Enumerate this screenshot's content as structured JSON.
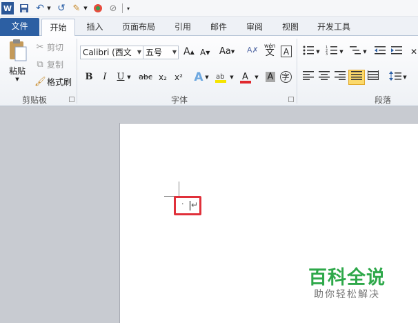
{
  "quick_access": {
    "icons": [
      "word-icon",
      "save-icon",
      "undo-icon",
      "redo-icon",
      "format-painter-icon",
      "color-icon",
      "clear-icon",
      "customize-icon"
    ]
  },
  "tabs": {
    "file": "文件",
    "home": "开始",
    "insert": "插入",
    "page_layout": "页面布局",
    "references": "引用",
    "mailings": "邮件",
    "review": "审阅",
    "view": "视图",
    "developer": "开发工具"
  },
  "clipboard": {
    "paste": "粘贴",
    "cut": "剪切",
    "copy": "复制",
    "format_painter": "格式刷",
    "group_label": "剪贴板"
  },
  "font": {
    "font_name": "Calibri (西文",
    "font_size": "五号",
    "group_label": "字体",
    "bold": "B",
    "italic": "I",
    "underline": "U",
    "strikethrough": "abc",
    "subscript": "x₂",
    "superscript": "x²",
    "grow": "A",
    "shrink": "A",
    "change_case": "Aa",
    "font_color_letter": "A",
    "char_shade": "A",
    "enclose": "字",
    "phonetic": "wén",
    "phonetic_char": "文",
    "border_char": "A"
  },
  "paragraph": {
    "group_label": "段落"
  },
  "watermark": {
    "title": "百科全说",
    "subtitle": "助你轻松解决"
  }
}
